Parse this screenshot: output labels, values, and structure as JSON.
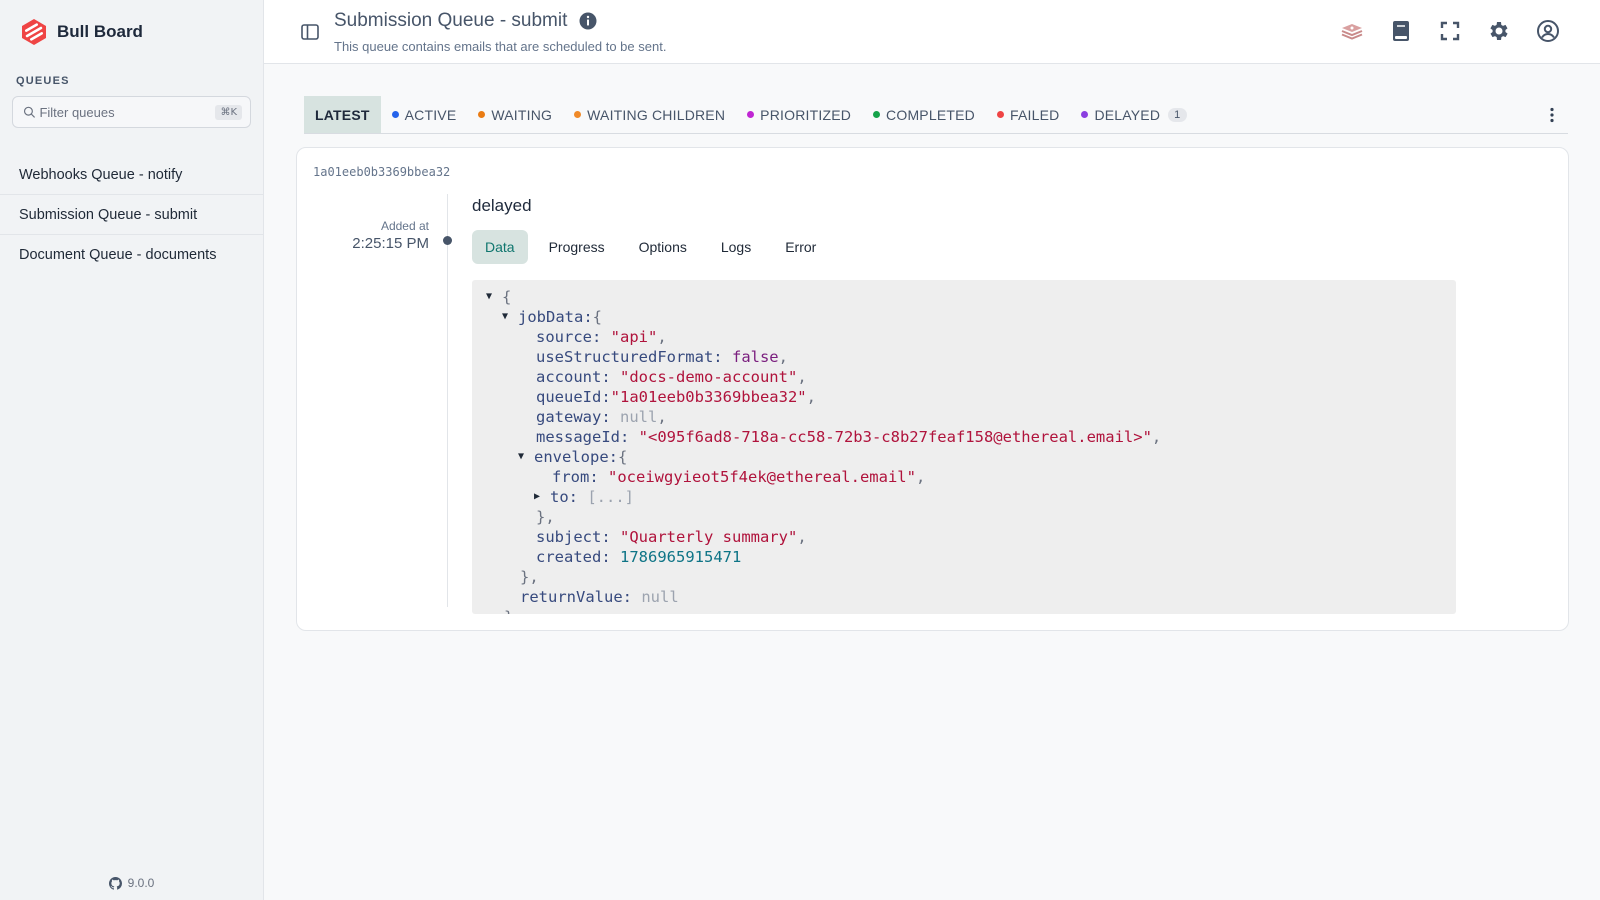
{
  "sidebar": {
    "brand": "Bull Board",
    "queues_heading": "QUEUES",
    "filter_placeholder": "Filter queues",
    "filter_shortcut": "⌘K",
    "queues": [
      {
        "label": "Webhooks Queue - notify"
      },
      {
        "label": "Submission Queue - submit"
      },
      {
        "label": "Document Queue - documents"
      }
    ],
    "version": "9.0.0"
  },
  "header": {
    "title": "Submission Queue - submit",
    "subtitle": "This queue contains emails that are scheduled to be sent."
  },
  "status_tabs": [
    {
      "label": "LATEST",
      "color": null,
      "active": true
    },
    {
      "label": "ACTIVE",
      "color": "#2563eb"
    },
    {
      "label": "WAITING",
      "color": "#ea7c13"
    },
    {
      "label": "WAITING CHILDREN",
      "color": "#f08a28"
    },
    {
      "label": "PRIORITIZED",
      "color": "#c026d3"
    },
    {
      "label": "COMPLETED",
      "color": "#16a34a"
    },
    {
      "label": "FAILED",
      "color": "#ef4444"
    },
    {
      "label": "DELAYED",
      "color": "#8b3fe0",
      "count": "1"
    }
  ],
  "job": {
    "id": "1a01eeb0b3369bbea32",
    "added_label": "Added at",
    "added_time": "2:25:15 PM",
    "status": "delayed",
    "tabs": [
      "Data",
      "Progress",
      "Options",
      "Logs",
      "Error"
    ],
    "active_tab": "Data"
  },
  "job_data": {
    "source": "\"api\"",
    "useStructuredFormat": "false",
    "account": "\"docs-demo-account\"",
    "queueId": "\"1a01eeb0b3369bbea32\"",
    "gateway": "null",
    "messageId": "\"<095f6ad8-718a-cc58-72b3-c8b27feaf158@ethereal.email>\"",
    "envelope_from": "\"oceiwgyieot5f4ek@ethereal.email\"",
    "envelope_to": "[...]",
    "subject": "\"Quarterly summary\"",
    "created": "1786965915471",
    "returnValue": "null"
  },
  "colors": {
    "accent": "#0f766e",
    "accent_bg": "#d7e3e0",
    "string": "#b0133c",
    "key": "#374a7e",
    "number": "#0e7486"
  }
}
